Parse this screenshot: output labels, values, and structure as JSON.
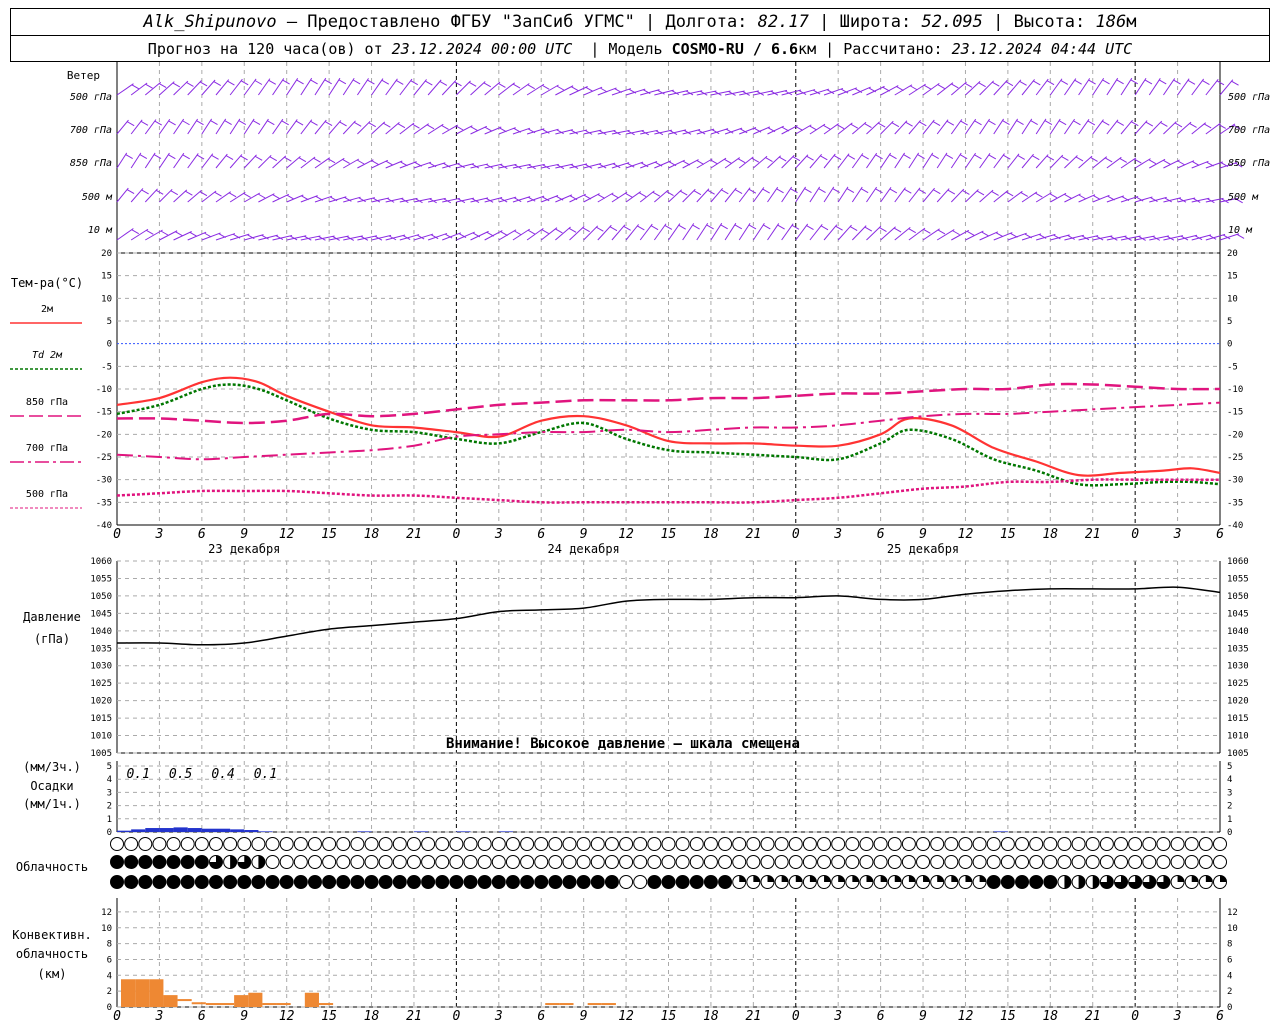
{
  "header": {
    "station": "Alk_Shipunovo",
    "provider": "– Предоставлено ФГБУ \"ЗапСиб УГМС\"",
    "lon_label": "Долгота:",
    "lon_value": "82.17",
    "lat_label": "Широта:",
    "lat_value": "52.095",
    "alt_label": "Высота:",
    "alt_value": "186",
    "alt_unit": "м",
    "forecast_label": "Прогноз на 120 часа(ов) от",
    "forecast_start": "23.12.2024 00:00 UTC",
    "model_label": "Модель",
    "model_name": "COSMO-RU / 6.6",
    "model_unit": "км",
    "computed_label": "Рассчитано:",
    "computed_time": "23.12.2024 04:44 UTC"
  },
  "panels": {
    "wind": {
      "title": "Ветер",
      "levels": [
        "500 гПа",
        "700 гПа",
        "850 гПа",
        "500 м",
        "10  м"
      ]
    },
    "temperature": {
      "title": "Тем-ра(°C)",
      "legend": [
        {
          "label": "2м",
          "color": "#ff3333",
          "dash": "solid"
        },
        {
          "label": "Td  2м",
          "color": "#007700",
          "dash": "dotted"
        },
        {
          "label": "850 гПа",
          "color": "#e0147e",
          "dash": "long-dash"
        },
        {
          "label": "700 гПа",
          "color": "#e0147e",
          "dash": "dash-dot"
        },
        {
          "label": "500 гПа",
          "color": "#e0147e",
          "dash": "dotted"
        }
      ],
      "yticks": [
        "20",
        "15",
        "10",
        "5",
        "0",
        "-5",
        "-10",
        "-15",
        "-20",
        "-25",
        "-30",
        "-35",
        "-40"
      ]
    },
    "time_axis": {
      "hour_labels": [
        "0",
        "3",
        "6",
        "9",
        "12",
        "15",
        "18",
        "21",
        "0",
        "3",
        "6",
        "9",
        "12",
        "15",
        "18",
        "21",
        "0",
        "3",
        "6",
        "9",
        "12",
        "15",
        "18",
        "21",
        "0",
        "3",
        "6"
      ],
      "dates": [
        "23 декабря",
        "24 декабря",
        "25 декабря"
      ]
    },
    "pressure": {
      "title": "Давление",
      "unit": "(гПа)",
      "yticks": [
        "1060",
        "1055",
        "1050",
        "1045",
        "1040",
        "1035",
        "1030",
        "1025",
        "1020",
        "1015",
        "1010",
        "1005"
      ],
      "warning": "Внимание! Высокое давление – шкала смещена"
    },
    "precip": {
      "unit_top": "(мм/3ч.)",
      "title": "Осадки",
      "unit_bottom": "(мм/1ч.)",
      "yticks": [
        "5",
        "4",
        "3",
        "2",
        "1",
        "0"
      ],
      "labels": [
        "0.1",
        "0.5",
        "0.4",
        "0.1"
      ]
    },
    "cloud": {
      "title": "Облачность"
    },
    "convective": {
      "title_line1": "Конвективн.",
      "title_line2": "облачность",
      "title_line3": "(км)",
      "yticks": [
        "12",
        "10",
        "8",
        "6",
        "4",
        "2",
        "0"
      ]
    }
  },
  "chart_data": [
    {
      "type": "line",
      "title": "Тем-ра(°C)",
      "x_unit": "hours since 23.12.2024 00:00 UTC",
      "ylim": [
        -40,
        20
      ],
      "series": [
        {
          "name": "2м",
          "color": "#ff3333",
          "x": [
            0,
            3,
            6,
            8,
            10,
            12,
            15,
            18,
            21,
            24,
            27,
            30,
            33,
            36,
            39,
            42,
            45,
            48,
            51,
            54,
            56,
            59,
            62,
            65,
            68,
            71,
            74,
            76,
            78
          ],
          "y": [
            -13.5,
            -12,
            -8.5,
            -7.5,
            -8.5,
            -11.5,
            -15,
            -18,
            -18.5,
            -19.5,
            -20.5,
            -17,
            -16,
            -18,
            -21.5,
            -22,
            -22,
            -22.5,
            -22.5,
            -20,
            -16.5,
            -18,
            -23,
            -26,
            -29,
            -28.5,
            -28,
            -27.5,
            -28.5
          ]
        },
        {
          "name": "Td  2м",
          "color": "#007700",
          "x": [
            0,
            3,
            6,
            8,
            10,
            12,
            15,
            18,
            21,
            24,
            27,
            30,
            33,
            36,
            39,
            42,
            45,
            48,
            51,
            54,
            56,
            59,
            62,
            65,
            68,
            71,
            74,
            76,
            78
          ],
          "y": [
            -15.5,
            -13.5,
            -10,
            -9,
            -10,
            -12.5,
            -16.5,
            -19,
            -19.5,
            -21,
            -22,
            -19.5,
            -17.5,
            -21,
            -23.5,
            -24,
            -24.5,
            -25,
            -25.5,
            -22,
            -19,
            -21,
            -25.5,
            -28,
            -31,
            -31,
            -30.5,
            -30.5,
            -31
          ]
        },
        {
          "name": "850 гПа",
          "color": "#e0147e",
          "x": [
            0,
            3,
            6,
            9,
            12,
            15,
            18,
            21,
            24,
            27,
            30,
            33,
            36,
            39,
            42,
            45,
            48,
            51,
            54,
            57,
            60,
            63,
            66,
            69,
            72,
            75,
            78
          ],
          "y": [
            -16.5,
            -16.5,
            -17,
            -17.5,
            -17,
            -15.5,
            -16,
            -15.5,
            -14.5,
            -13.5,
            -13,
            -12.5,
            -12.5,
            -12.5,
            -12,
            -12,
            -11.5,
            -11,
            -11,
            -10.5,
            -10,
            -10,
            -9,
            -9,
            -9.5,
            -10,
            -10
          ]
        },
        {
          "name": "700 гПа",
          "color": "#e0147e",
          "x": [
            0,
            3,
            6,
            9,
            12,
            15,
            18,
            21,
            24,
            27,
            30,
            33,
            36,
            39,
            42,
            45,
            48,
            51,
            54,
            57,
            60,
            63,
            66,
            69,
            72,
            75,
            78
          ],
          "y": [
            -24.5,
            -25,
            -25.5,
            -25,
            -24.5,
            -24,
            -23.5,
            -22.5,
            -20.5,
            -20,
            -19.5,
            -19.5,
            -19,
            -19.5,
            -19,
            -18.5,
            -18.5,
            -18,
            -17,
            -16,
            -15.5,
            -15.5,
            -15,
            -14.5,
            -14,
            -13.5,
            -13
          ]
        },
        {
          "name": "500 гПа",
          "color": "#e0147e",
          "x": [
            0,
            3,
            6,
            9,
            12,
            15,
            18,
            21,
            24,
            27,
            30,
            33,
            36,
            39,
            42,
            45,
            48,
            51,
            54,
            57,
            60,
            63,
            66,
            69,
            72,
            75,
            78
          ],
          "y": [
            -33.5,
            -33,
            -32.5,
            -32.5,
            -32.5,
            -33,
            -33.5,
            -33.5,
            -34,
            -34.5,
            -35,
            -35,
            -35,
            -35,
            -35,
            -35,
            -34.5,
            -34,
            -33,
            -32,
            -31.5,
            -30.5,
            -30.5,
            -30,
            -30,
            -30,
            -30
          ]
        }
      ]
    },
    {
      "type": "line",
      "title": "Давление",
      "ylim": [
        1005,
        1060
      ],
      "series": [
        {
          "name": "",
          "color": "#000000",
          "x": [
            0,
            3,
            6,
            9,
            12,
            15,
            18,
            21,
            24,
            27,
            30,
            33,
            36,
            39,
            42,
            45,
            48,
            51,
            54,
            57,
            60,
            63,
            66,
            69,
            72,
            75,
            78
          ],
          "y": [
            1036.5,
            1036.5,
            1036,
            1036.5,
            1038.5,
            1040.5,
            1041.5,
            1042.5,
            1043.5,
            1045.5,
            1046,
            1046.5,
            1048.5,
            1049,
            1049,
            1049.5,
            1049.5,
            1050,
            1049,
            1049,
            1050.5,
            1051.5,
            1052,
            1052,
            1052,
            1052.5,
            1051
          ]
        }
      ]
    },
    {
      "type": "bar",
      "title": "Осадки",
      "x_unit": "hours",
      "ylim": [
        0,
        5
      ],
      "x": [
        1,
        2,
        3,
        4,
        5,
        6,
        7,
        8,
        9,
        10,
        11,
        18,
        22,
        25,
        28,
        63
      ],
      "values": [
        0.1,
        0.2,
        0.3,
        0.3,
        0.35,
        0.3,
        0.25,
        0.25,
        0.2,
        0.15,
        0.05,
        0.05,
        0.05,
        0.05,
        0.05,
        0.05
      ]
    },
    {
      "type": "bar",
      "title": "Конвективн. облачность",
      "ylim": [
        0,
        13
      ],
      "x": [
        0,
        1,
        2,
        3,
        4,
        5,
        6,
        7,
        8,
        9,
        10,
        11,
        13,
        14,
        30,
        31,
        33,
        34
      ],
      "values": [
        3.5,
        3.5,
        3.5,
        1.5,
        1,
        0.6,
        0.5,
        0.5,
        1.5,
        1.8,
        0.5,
        0.5,
        1.8,
        0.5,
        0.5,
        0.5,
        0.5,
        0.5
      ]
    }
  ]
}
